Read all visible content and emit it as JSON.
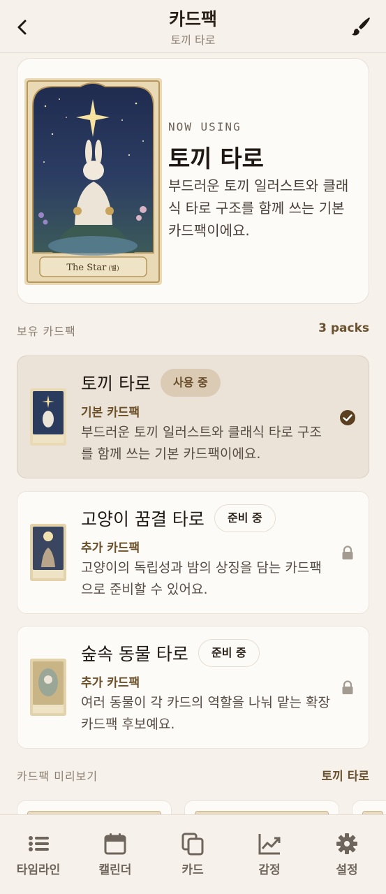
{
  "header": {
    "title": "카드팩",
    "subtitle": "토끼 타로"
  },
  "hero": {
    "eyebrow": "NOW USING",
    "name": "토끼 타로",
    "description": "부드러운 토끼 일러스트와 클래식 타로 구조를 함께 쓰는 기본 카드팩이에요.",
    "card_caption": "The Star",
    "card_caption_sub": "(별)"
  },
  "owned_section": {
    "label": "보유 카드팩",
    "count": "3 packs"
  },
  "packs": [
    {
      "name": "토끼 타로",
      "badge": "사용 중",
      "kind": "기본 카드팩",
      "description": "부드러운 토끼 일러스트와 클래식 타로 구조를 함께 쓰는 기본 카드팩이에요.",
      "status_icon": "check-circle-icon"
    },
    {
      "name": "고양이 꿈결 타로",
      "badge": "준비 중",
      "kind": "추가 카드팩",
      "description": "고양이의 독립성과 밤의 상징을 담는 카드팩으로 준비할 수 있어요.",
      "status_icon": "lock-icon"
    },
    {
      "name": "숲속 동물 타로",
      "badge": "준비 중",
      "kind": "추가 카드팩",
      "description": "여러 동물이 각 카드의 역할을 나눠 맡는 확장 카드팩 후보예요.",
      "status_icon": "lock-icon"
    }
  ],
  "preview_section": {
    "label": "카드팩 미리보기",
    "selected": "토끼 타로"
  },
  "nav": [
    {
      "label": "타임라인",
      "icon": "list-icon"
    },
    {
      "label": "캘린더",
      "icon": "calendar-icon"
    },
    {
      "label": "카드",
      "icon": "cards-icon"
    },
    {
      "label": "감정",
      "icon": "chart-icon"
    },
    {
      "label": "설정",
      "icon": "gear-icon"
    }
  ],
  "colors": {
    "background": "#f6f1ea",
    "accent": "#6a5230",
    "active_card": "#ebe3d8"
  }
}
